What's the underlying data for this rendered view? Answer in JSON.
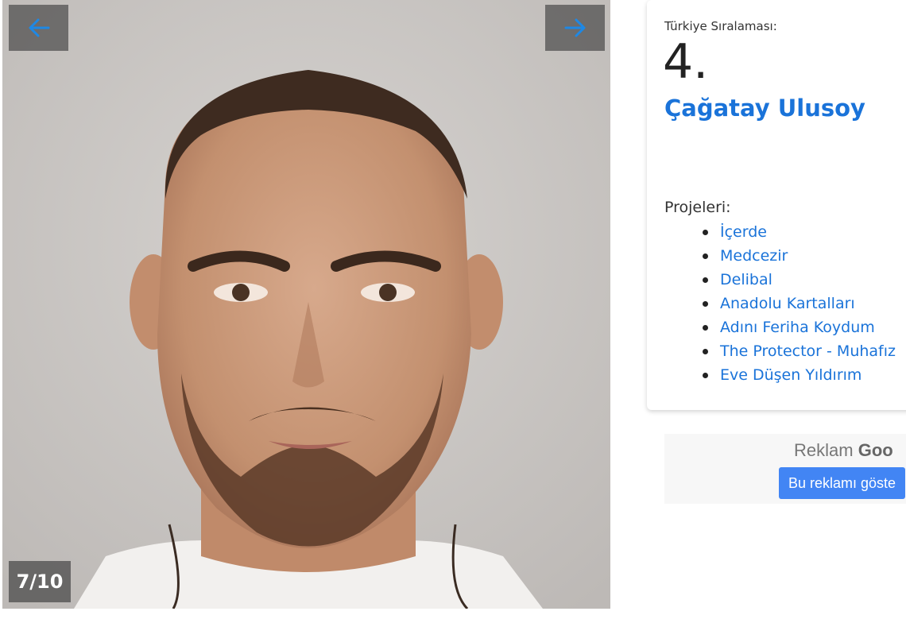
{
  "gallery": {
    "counter": "7/10",
    "prev_icon": "arrow-left-icon",
    "next_icon": "arrow-right-icon"
  },
  "info": {
    "rank_label": "Türkiye Sıralaması:",
    "rank_value": "4.",
    "name": "Çağatay Ulusoy",
    "projects_label": "Projeleri:",
    "projects": [
      "İçerde",
      "Medcezir",
      "Delibal",
      "Anadolu Kartalları",
      "Adını Feriha Koydum",
      "The Protector - Muhafız",
      "Eve Düşen Yıldırım"
    ]
  },
  "ad": {
    "label_prefix": "Reklam",
    "label_brand": "Goo",
    "button": "Bu reklamı göste"
  },
  "colors": {
    "link": "#1a73d9",
    "nav_arrow": "#1e88e5",
    "ad_button": "#4285f4"
  }
}
